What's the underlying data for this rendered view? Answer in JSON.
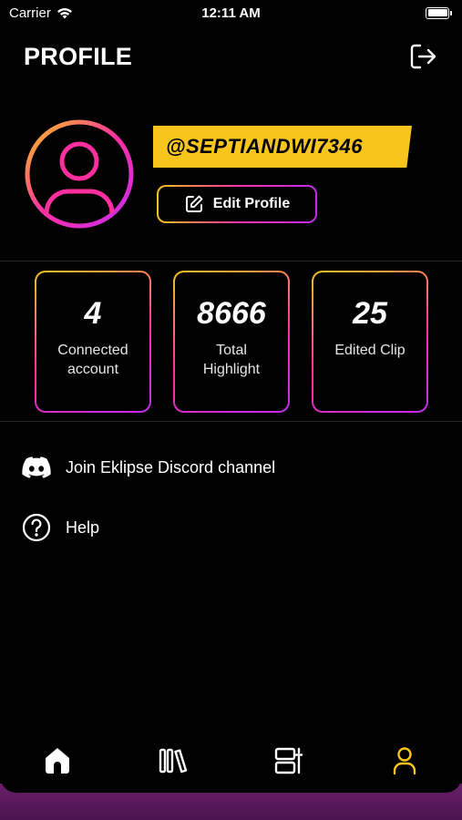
{
  "status_bar": {
    "carrier": "Carrier",
    "time": "12:11 AM"
  },
  "header": {
    "title": "PROFILE"
  },
  "profile": {
    "username": "@SEPTIANDWI7346",
    "edit_label": "Edit Profile"
  },
  "stats": [
    {
      "value": "4",
      "label": "Connected account"
    },
    {
      "value": "8666",
      "label": "Total Highlight"
    },
    {
      "value": "25",
      "label": "Edited Clip"
    }
  ],
  "menu": [
    {
      "icon": "discord-icon",
      "label": "Join Eklipse Discord channel"
    },
    {
      "icon": "help-icon",
      "label": "Help"
    }
  ],
  "tabs": [
    {
      "icon": "home-icon",
      "active": false
    },
    {
      "icon": "library-icon",
      "active": false
    },
    {
      "icon": "editor-icon",
      "active": false
    },
    {
      "icon": "profile-icon",
      "active": true
    }
  ],
  "colors": {
    "accent_yellow": "#f7c51d",
    "accent_pink": "#ff2fa0",
    "accent_purple": "#c22cf0"
  }
}
